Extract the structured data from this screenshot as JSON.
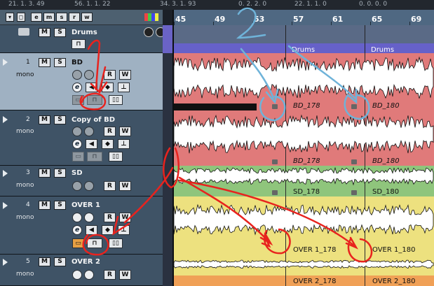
{
  "top_positions": [
    "21. 1. 3. 49",
    "56. 1. 1. 22",
    "34. 3. 1. 93",
    "0. 2. 2. 0",
    "22. 1. 1. 0",
    "0. 0. 0. 0"
  ],
  "ruler_labels": [
    "45",
    "49",
    "53",
    "57",
    "61",
    "65",
    "69"
  ],
  "header_buttons": {
    "e": "e",
    "m": "m",
    "s": "s",
    "r": "r",
    "w": "w"
  },
  "tracks": [
    {
      "number": "",
      "name": "Drums",
      "sub": "",
      "m": "M",
      "s": "S",
      "type": "folder"
    },
    {
      "number": "1",
      "name": "BD",
      "sub": "mono",
      "m": "M",
      "s": "S",
      "r": "R",
      "w": "W",
      "e": "e"
    },
    {
      "number": "2",
      "name": "Copy of BD",
      "sub": "mono",
      "m": "M",
      "s": "S",
      "r": "R",
      "w": "W",
      "e": "e"
    },
    {
      "number": "3",
      "name": "SD",
      "sub": "mono",
      "m": "M",
      "s": "S",
      "r": "R",
      "w": "W"
    },
    {
      "number": "4",
      "name": "OVER 1",
      "sub": "mono",
      "m": "M",
      "s": "S",
      "r": "R",
      "w": "W",
      "e": "e"
    },
    {
      "number": "5",
      "name": "OVER 2",
      "sub": "mono",
      "m": "M",
      "s": "S",
      "r": "R",
      "w": "W"
    }
  ],
  "folder_part_labels": [
    "Drums",
    "Drums"
  ],
  "clips": {
    "bd": [
      "BD_178",
      "BD_180"
    ],
    "copy_bd": [
      "BD_178",
      "BD_180"
    ],
    "sd": [
      "SD_178",
      "SD_180"
    ],
    "over1": [
      "OVER 1_178",
      "OVER 1_180"
    ],
    "over2": [
      "OVER 2_178",
      "OVER 2_180"
    ]
  },
  "colors": {
    "folder_lane": "#6661c9",
    "bd_lane": "#e07a7a",
    "sd_lane": "#8fc57c",
    "over1_lane": "#ede17f",
    "over2_lane": "#f0a056",
    "track_panel": "#3f5366",
    "selected_track_panel": "#9fb1c2",
    "annotation_red": "#e8231e",
    "annotation_blue": "#6fb3d9"
  },
  "annotations": [
    "1",
    "2"
  ]
}
